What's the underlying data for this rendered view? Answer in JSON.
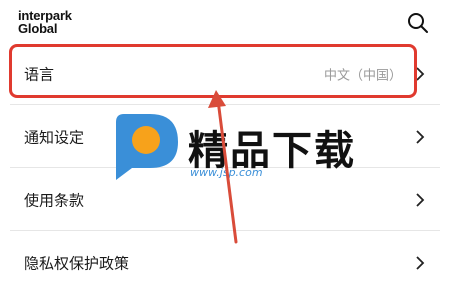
{
  "header": {
    "logo_line1": "interpark",
    "logo_line2": "Global",
    "search_icon": "search-icon"
  },
  "settings": {
    "items": [
      {
        "label": "语言",
        "value": "中文（中国）"
      },
      {
        "label": "通知设定",
        "value": ""
      },
      {
        "label": "使用条款",
        "value": ""
      },
      {
        "label": "隐私权保护政策",
        "value": ""
      }
    ]
  },
  "watermark": {
    "text": "精品下载",
    "url": "www.jsp.com",
    "logo_icon": "p-logo-icon"
  },
  "colors": {
    "highlight": "#e03a2f",
    "arrow": "#d94c3a",
    "watermark_blue": "#3a8fd8",
    "watermark_orange": "#f7a21b"
  }
}
